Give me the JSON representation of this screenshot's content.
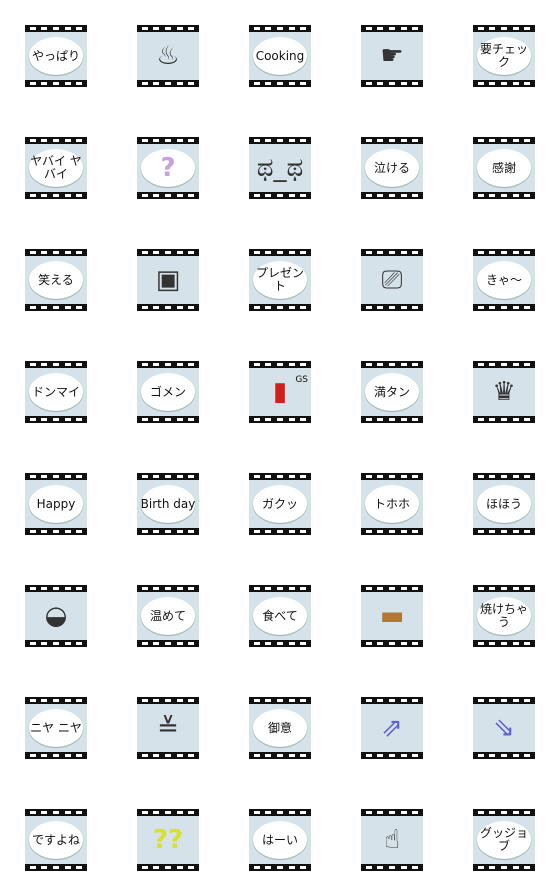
{
  "colors": {
    "film": "#111111",
    "frame_bg": "#d6e2ea",
    "bubble": "#ffffff"
  },
  "stickers": [
    {
      "text": "やっぱり",
      "bubble": true
    },
    {
      "icon": "chef-hat-icon",
      "glyph": "♨",
      "bubble": false
    },
    {
      "text": "Cooking",
      "bubble": true
    },
    {
      "icon": "pointing-hand-icon",
      "glyph": "☛",
      "bubble": false
    },
    {
      "text": "要チェック",
      "bubble": true
    },
    {
      "text": "ヤバイ ヤバイ",
      "bubble": true
    },
    {
      "icon": "question-mark-icon",
      "glyph": "?",
      "bubble": true,
      "cls": "ic-q"
    },
    {
      "icon": "crying-face-icon",
      "glyph": "ಥ_ಥ",
      "bubble": false
    },
    {
      "text": "泣ける",
      "bubble": true
    },
    {
      "text": "感謝",
      "bubble": true
    },
    {
      "text": "笑える",
      "bubble": true
    },
    {
      "icon": "gift-box-icon",
      "glyph": "▣",
      "bubble": false
    },
    {
      "text": "プレゼント",
      "bubble": true
    },
    {
      "icon": "movie-camera-icon",
      "glyph": "⎚",
      "bubble": false
    },
    {
      "text": "きゃ〜",
      "bubble": true
    },
    {
      "text": "ドンマイ",
      "bubble": true
    },
    {
      "text": "ゴメン",
      "bubble": true
    },
    {
      "icon": "gas-pump-icon",
      "glyph": "▮",
      "bubble": false,
      "cls": "ic-gas",
      "extra": "GS"
    },
    {
      "text": "満タン",
      "bubble": true
    },
    {
      "icon": "birthday-cake-icon",
      "glyph": "♛",
      "bubble": false
    },
    {
      "text": "Happy",
      "bubble": true
    },
    {
      "text": "Birth day",
      "bubble": true
    },
    {
      "text": "ガクッ",
      "bubble": true
    },
    {
      "text": "トホホ",
      "bubble": true
    },
    {
      "text": "ほほう",
      "bubble": true
    },
    {
      "icon": "cooking-pot-icon",
      "glyph": "◒",
      "bubble": false
    },
    {
      "text": "温めて",
      "bubble": true
    },
    {
      "text": "食べて",
      "bubble": true
    },
    {
      "icon": "bread-loaf-icon",
      "glyph": "▬",
      "bubble": false,
      "cls": "ic-bread"
    },
    {
      "text": "焼けちゃう",
      "bubble": true
    },
    {
      "text": "ニヤ ニヤ",
      "bubble": true
    },
    {
      "icon": "grinning-face-icon",
      "glyph": "≚",
      "bubble": false
    },
    {
      "text": "御意",
      "bubble": true
    },
    {
      "icon": "arrows-up-right-icon",
      "glyph": "⇗",
      "bubble": false,
      "cls": "ic-arrow"
    },
    {
      "icon": "arrows-down-right-icon",
      "glyph": "⇘",
      "bubble": false,
      "cls": "ic-arrow"
    },
    {
      "text": "ですよね",
      "bubble": true
    },
    {
      "icon": "double-question-icon",
      "glyph": "??",
      "bubble": false,
      "cls": "ic-q2"
    },
    {
      "text": "はーい",
      "bubble": true
    },
    {
      "icon": "thumbs-up-icon",
      "glyph": "☝",
      "bubble": false
    },
    {
      "text": "グッジョブ",
      "bubble": true
    }
  ]
}
